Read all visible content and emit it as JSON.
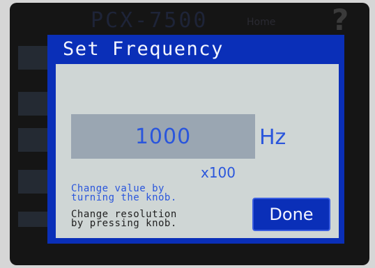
{
  "background_app": {
    "title": "PCX-7500",
    "home_label": "Home",
    "help_icon": "?"
  },
  "dialog": {
    "title": "Set Frequency",
    "value": "1000",
    "unit": "Hz",
    "resolution": "x100",
    "hint_knob": "Change value by\nturning the knob.",
    "hint_resolution": "Change resolution\nby pressing knob.",
    "done_label": "Done"
  },
  "colors": {
    "dialog_blue": "#0a2fb8",
    "body_bg": "#cfd6d5",
    "value_bg": "#9aa6b2",
    "accent_text": "#2a56dc"
  }
}
